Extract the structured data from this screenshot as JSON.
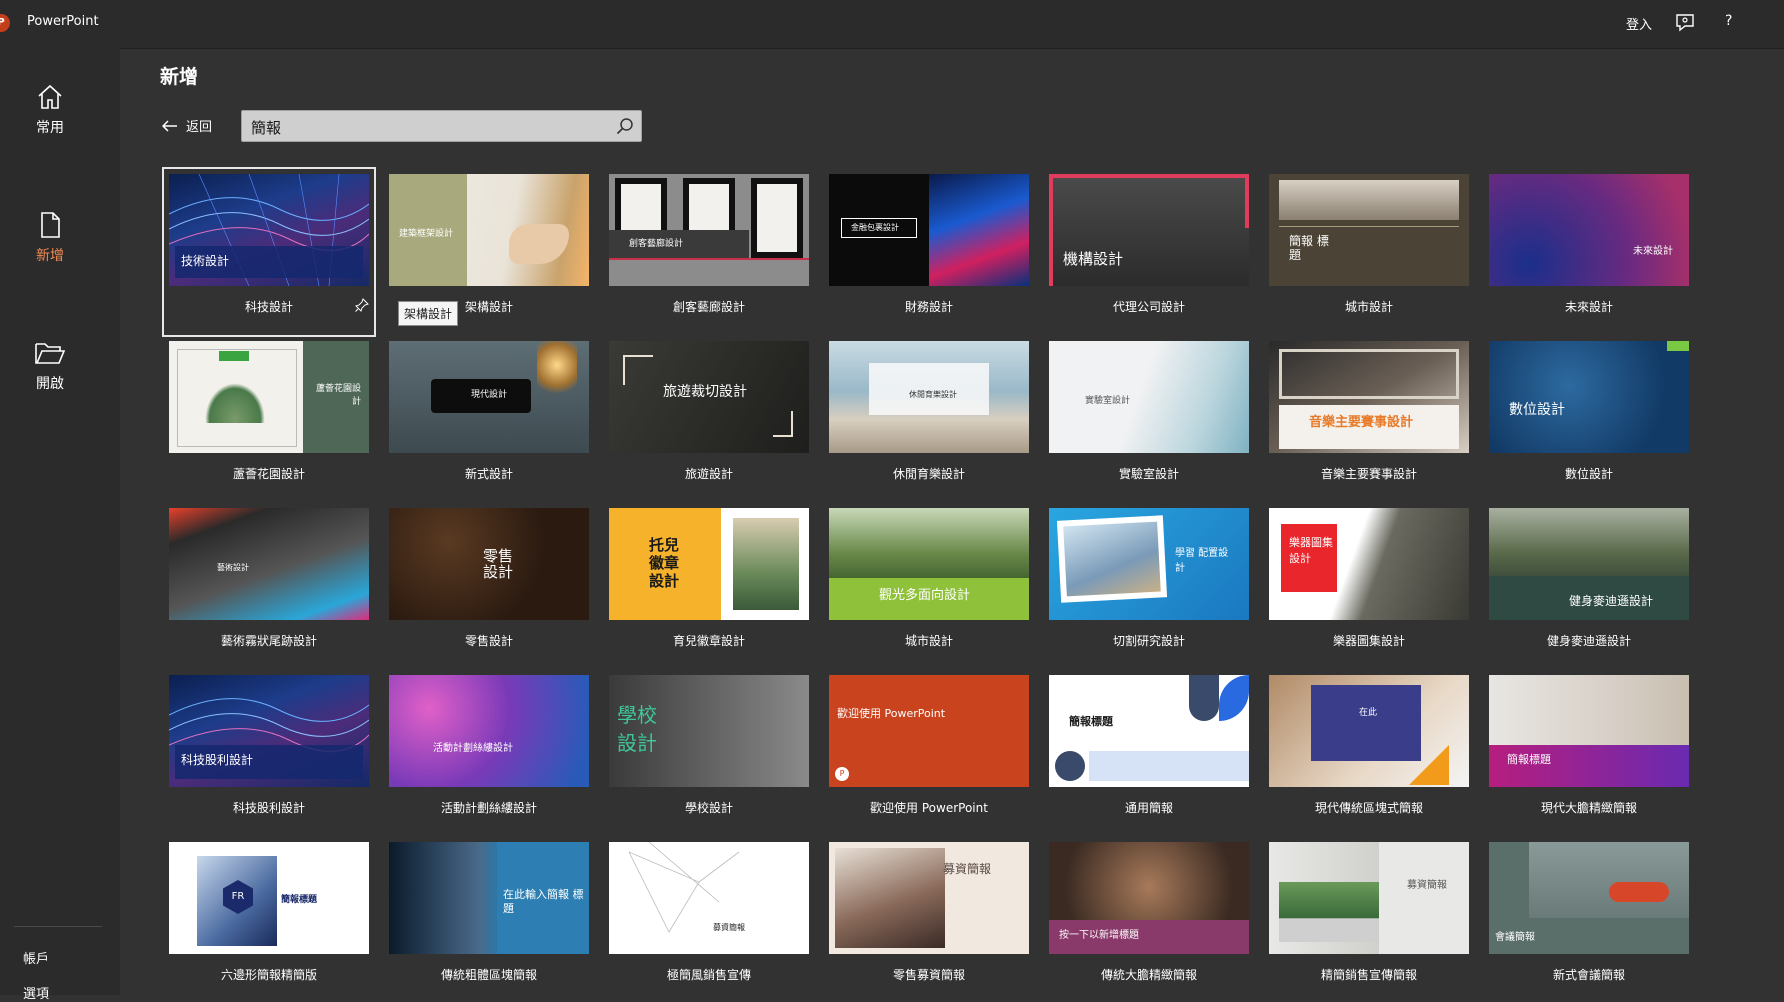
{
  "app": {
    "name": "PowerPoint",
    "icon_letter": "P"
  },
  "titlebar": {
    "signin": "登入",
    "help": "?"
  },
  "sidebar": {
    "items": [
      {
        "label": "常用"
      },
      {
        "label": "新增"
      },
      {
        "label": "開啟"
      }
    ],
    "bottom": [
      {
        "label": "帳戶"
      },
      {
        "label": "選項"
      }
    ]
  },
  "main": {
    "title": "新增",
    "back_label": "返回",
    "search_value": "簡報"
  },
  "tooltip": "架構設計",
  "templates": [
    {
      "label": "科技設計",
      "thumb_text": "技術設計"
    },
    {
      "label": "架構設計",
      "thumb_text": "建築框架設計"
    },
    {
      "label": "創客藝廊設計",
      "thumb_text": "創客藝廊設計"
    },
    {
      "label": "財務設計",
      "thumb_text": "金融包裹設計"
    },
    {
      "label": "代理公司設計",
      "thumb_text": "機構設計"
    },
    {
      "label": "城市設計",
      "thumb_text": "簡報 標題"
    },
    {
      "label": "未來設計",
      "thumb_text": "未來設計"
    },
    {
      "label": "蘆薈花園設計",
      "thumb_text": "蘆薈花園設計"
    },
    {
      "label": "新式設計",
      "thumb_text": "現代設計"
    },
    {
      "label": "旅遊設計",
      "thumb_text": "旅遊裁切設計"
    },
    {
      "label": "休閒育樂設計",
      "thumb_text": "休閒育樂設計"
    },
    {
      "label": "實驗室設計",
      "thumb_text": "實驗室設計"
    },
    {
      "label": "音樂主要賽事設計",
      "thumb_text": "音樂主要賽事設計"
    },
    {
      "label": "數位設計",
      "thumb_text": "數位設計"
    },
    {
      "label": "藝術霧狀尾跡設計",
      "thumb_text": "藝術設計"
    },
    {
      "label": "零售設計",
      "thumb_text": "零售 設計"
    },
    {
      "label": "育兒徽章設計",
      "thumb_text": "托兒 徽章 設計"
    },
    {
      "label": "城市設計",
      "thumb_text": "觀光多面向設計"
    },
    {
      "label": "切割研究設計",
      "thumb_text": "學習 配置設計"
    },
    {
      "label": "樂器圖集設計",
      "thumb_text": "樂器圖集 設計"
    },
    {
      "label": "健身麥迪遜設計",
      "thumb_text": "健身麥迪遜設計"
    },
    {
      "label": "科技股利設計",
      "thumb_text": "科技股利設計"
    },
    {
      "label": "活動計劃絲縷設計",
      "thumb_text": "活動計劃絲縷設計"
    },
    {
      "label": "學校設計",
      "thumb_text": "學校 設計"
    },
    {
      "label": "歡迎使用 PowerPoint",
      "thumb_text": "歡迎使用 PowerPoint"
    },
    {
      "label": "通用簡報",
      "thumb_text": "簡報標題"
    },
    {
      "label": "現代傳統區塊式簡報",
      "thumb_text": "在此"
    },
    {
      "label": "現代大膽精緻簡報",
      "thumb_text": "簡報標題"
    },
    {
      "label": "六邊形簡報精簡版",
      "thumb_text": "簡報標題"
    },
    {
      "label": "傳統粗體區塊簡報",
      "thumb_text": "在此輸入簡報 標題"
    },
    {
      "label": "極簡風銷售宣傳",
      "thumb_text": "募資簡報"
    },
    {
      "label": "零售募資簡報",
      "thumb_text": "募資簡報"
    },
    {
      "label": "傳統大膽精緻簡報",
      "thumb_text": "按一下以新增標題"
    },
    {
      "label": "精簡銷售宣傳簡報",
      "thumb_text": "募資簡報"
    },
    {
      "label": "新式會議簡報",
      "thumb_text": "會議簡報"
    }
  ],
  "colors": {
    "accent": "#f28b54",
    "titlebar": "#2b2b2b",
    "background": "#323232"
  }
}
